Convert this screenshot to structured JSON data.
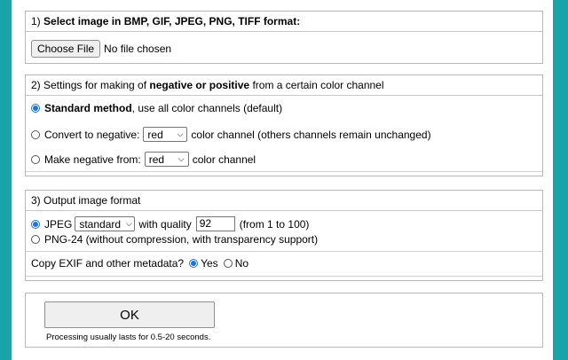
{
  "section1": {
    "number": "1)",
    "title": "Select image in BMP, GIF, JPEG, PNG, TIFF format:",
    "choose_file_label": "Choose File",
    "no_file_text": "No file chosen"
  },
  "section2": {
    "title_prefix": "2) Settings for making of",
    "title_bold": "negative or positive",
    "title_suffix": "from a certain color channel",
    "option1_bold": "Standard method",
    "option1_rest": ", use all color channels (default)",
    "option2_label": "Convert to negative:",
    "option2_select": "red",
    "option2_suffix": "color channel (others channels remain unchanged)",
    "option3_label": "Make negative from:",
    "option3_select": "red",
    "option3_suffix": "color channel"
  },
  "section3": {
    "title": "3) Output image format",
    "jpeg_label": "JPEG",
    "jpeg_select": "standard",
    "quality_label": "with quality",
    "quality_value": "92",
    "quality_range": "(from 1 to 100)",
    "png_label": "PNG-24 (without compression, with transparency support)",
    "exif_label": "Copy EXIF and other metadata?",
    "yes_label": "Yes",
    "no_label": "No"
  },
  "submit": {
    "ok_label": "OK",
    "note": "Processing usually lasts for 0.5-20 seconds."
  },
  "colors": {
    "background": "#1aa3a8",
    "radio_accent": "#1a73e8"
  }
}
